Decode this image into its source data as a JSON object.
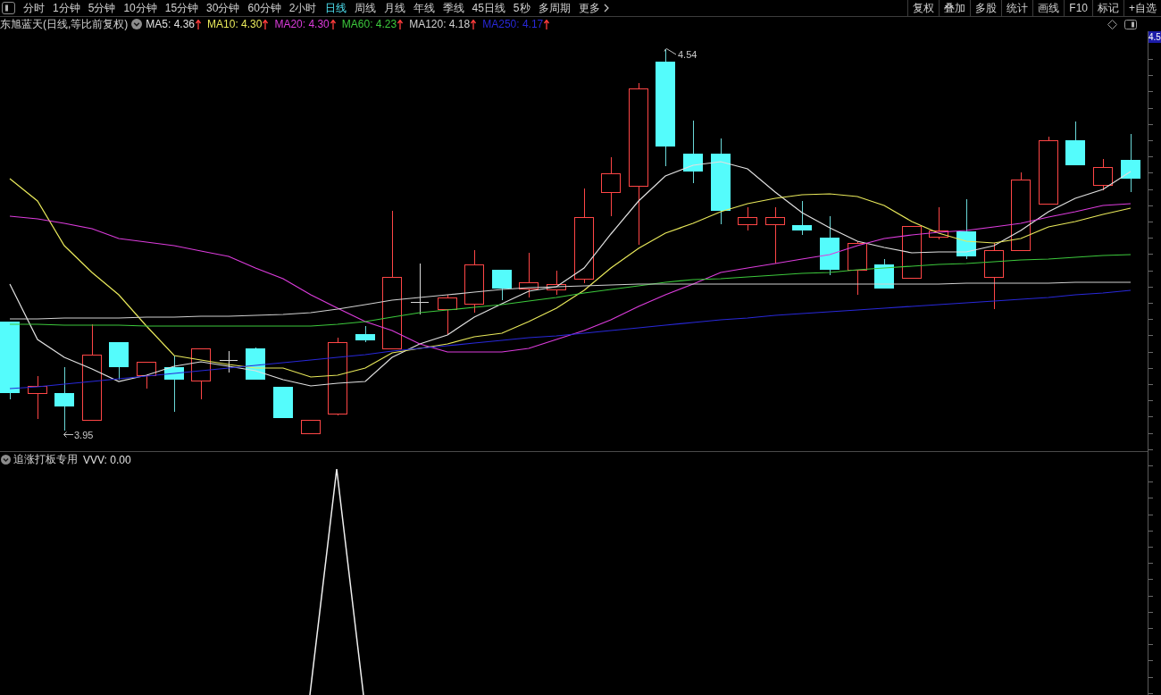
{
  "toolbar": {
    "periods": [
      {
        "label": "分时",
        "selected": false
      },
      {
        "label": "1分钟",
        "selected": false
      },
      {
        "label": "5分钟",
        "selected": false
      },
      {
        "label": "10分钟",
        "selected": false
      },
      {
        "label": "15分钟",
        "selected": false
      },
      {
        "label": "30分钟",
        "selected": false
      },
      {
        "label": "60分钟",
        "selected": false
      },
      {
        "label": "2小时",
        "selected": false
      },
      {
        "label": "日线",
        "selected": true
      },
      {
        "label": "周线",
        "selected": false
      },
      {
        "label": "月线",
        "selected": false
      },
      {
        "label": "年线",
        "selected": false
      },
      {
        "label": "季线",
        "selected": false
      },
      {
        "label": "45日线",
        "selected": false
      },
      {
        "label": "5秒",
        "selected": false
      },
      {
        "label": "多周期",
        "selected": false
      }
    ],
    "more": "更多",
    "actions": [
      "复权",
      "叠加",
      "多股",
      "统计",
      "画线",
      "F10",
      "标记",
      "+自选"
    ]
  },
  "chart_header": {
    "title": "东旭蓝天(日线,等比前复权)",
    "moving_averages": [
      {
        "label": "MA5: 4.36",
        "color": "#e0e0e0",
        "rising": true
      },
      {
        "label": "MA10: 4.30",
        "color": "#e8e85a",
        "rising": true
      },
      {
        "label": "MA20: 4.30",
        "color": "#dc3cdc",
        "rising": true
      },
      {
        "label": "MA60: 4.23",
        "color": "#3cc83c",
        "rising": true
      },
      {
        "label": "MA120: 4.18",
        "color": "#d0d0d0",
        "rising": true
      },
      {
        "label": "MA250: 4.17",
        "color": "#2828d8",
        "rising": true
      }
    ]
  },
  "price_chart": {
    "high_label": "4.54",
    "low_label": "3.95",
    "axis_label": "4.5"
  },
  "indicator": {
    "title": "追涨打板专用",
    "reading": "VVV: 0.00"
  }
}
